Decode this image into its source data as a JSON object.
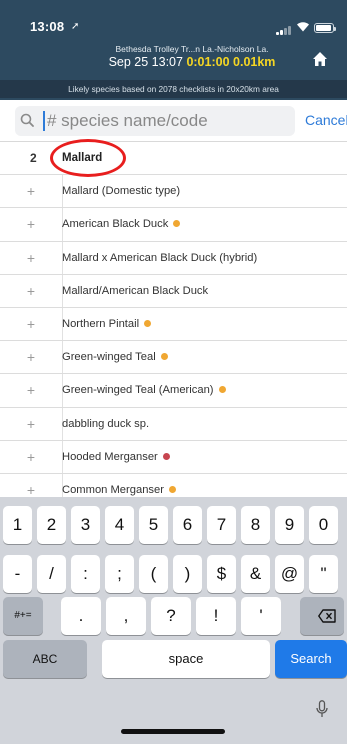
{
  "status_bar": {
    "time": "13:08",
    "nav_arrow": "➚"
  },
  "checklist": {
    "location": "Bethesda Trolley Tr...n La.-Nicholson La.",
    "start": "Sep 25 13:07",
    "duration": "0:01:00",
    "distance": "0.01km"
  },
  "info_bar": "Likely species based on 2078 checklists in 20x20km area",
  "search": {
    "placeholder": "# species name/code",
    "value": "",
    "cancel_label": "Cancel"
  },
  "species": [
    {
      "count": "2",
      "name": "Mallard",
      "badge": null
    },
    {
      "count": "+",
      "name": "Mallard (Domestic type)",
      "badge": null
    },
    {
      "count": "+",
      "name": "American Black Duck",
      "badge": "#f0a732"
    },
    {
      "count": "+",
      "name": "Mallard x American Black Duck (hybrid)",
      "badge": null
    },
    {
      "count": "+",
      "name": "Mallard/American Black Duck",
      "badge": null
    },
    {
      "count": "+",
      "name": "Northern Pintail",
      "badge": "#f0a732"
    },
    {
      "count": "+",
      "name": "Green-winged Teal",
      "badge": "#f0a732"
    },
    {
      "count": "+",
      "name": "Green-winged Teal (American)",
      "badge": "#f0a732"
    },
    {
      "count": "+",
      "name": "dabbling duck sp.",
      "badge": null
    },
    {
      "count": "+",
      "name": "Hooded Merganser",
      "badge": "#c74550"
    },
    {
      "count": "+",
      "name": "Common Merganser",
      "badge": "#f0a732"
    }
  ],
  "keyboard": {
    "row1": [
      "1",
      "2",
      "3",
      "4",
      "5",
      "6",
      "7",
      "8",
      "9",
      "0"
    ],
    "row2": [
      "-",
      "/",
      ":",
      ";",
      "(",
      ")",
      "$",
      "&",
      "@",
      "\""
    ],
    "row3": [
      ".",
      ",",
      "?",
      "!",
      "'"
    ],
    "shift_label": "#+=",
    "abc_label": "ABC",
    "space_label": "space",
    "search_label": "Search"
  },
  "colors": {
    "header": "#2d4a60",
    "accent": "#2e7bd8",
    "highlight": "#e81e1e",
    "timer": "#f5d623"
  }
}
